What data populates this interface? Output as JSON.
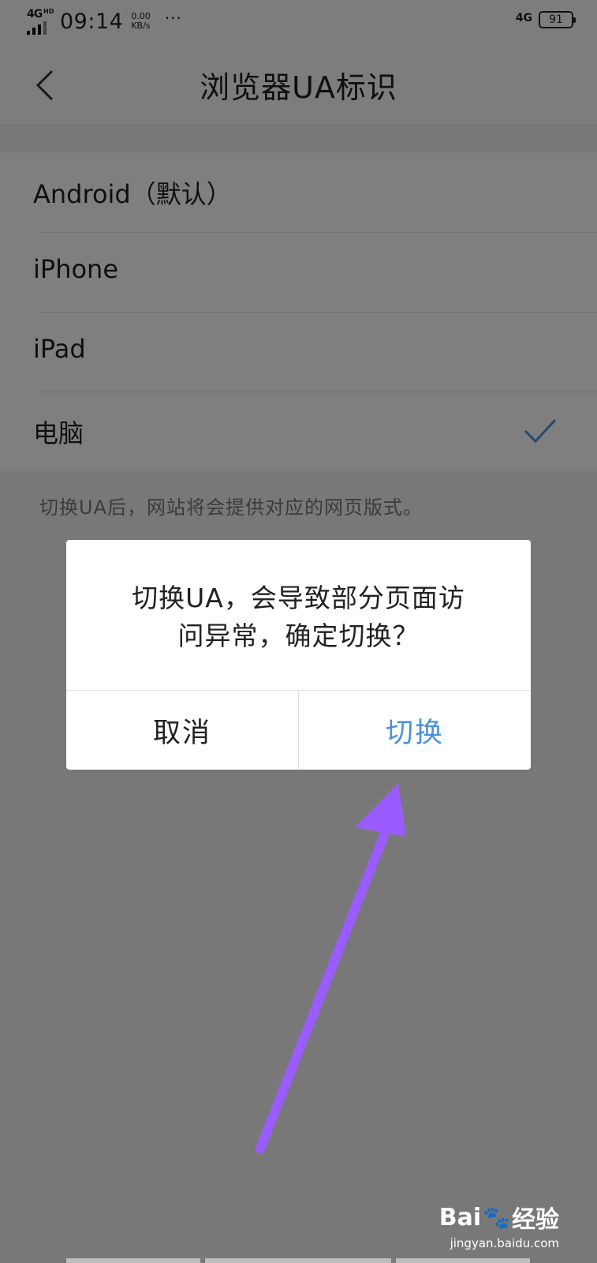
{
  "status_bar": {
    "network": "4G",
    "network_hd": "HD",
    "time": "09:14",
    "speed_value": "0.00",
    "speed_unit": "KB/s",
    "more": "···",
    "network_right": "4G",
    "battery": "91"
  },
  "header": {
    "title": "浏览器UA标识"
  },
  "ua_options": [
    {
      "label": "Android（默认）",
      "selected": false
    },
    {
      "label": "iPhone",
      "selected": false
    },
    {
      "label": "iPad",
      "selected": false
    },
    {
      "label": "电脑",
      "selected": true
    }
  ],
  "hint": "切换UA后，网站将会提供对应的网页版式。",
  "dialog": {
    "message_line1": "切换UA，会导致部分页面访",
    "message_line2": "问异常，确定切换？",
    "cancel_label": "取消",
    "confirm_label": "切换"
  },
  "colors": {
    "accent": "#4a90d9",
    "annotation_arrow": "#9b5cff"
  },
  "watermark": {
    "brand_left": "Bai",
    "brand_right": "经验",
    "url": "jingyan.baidu.com"
  }
}
